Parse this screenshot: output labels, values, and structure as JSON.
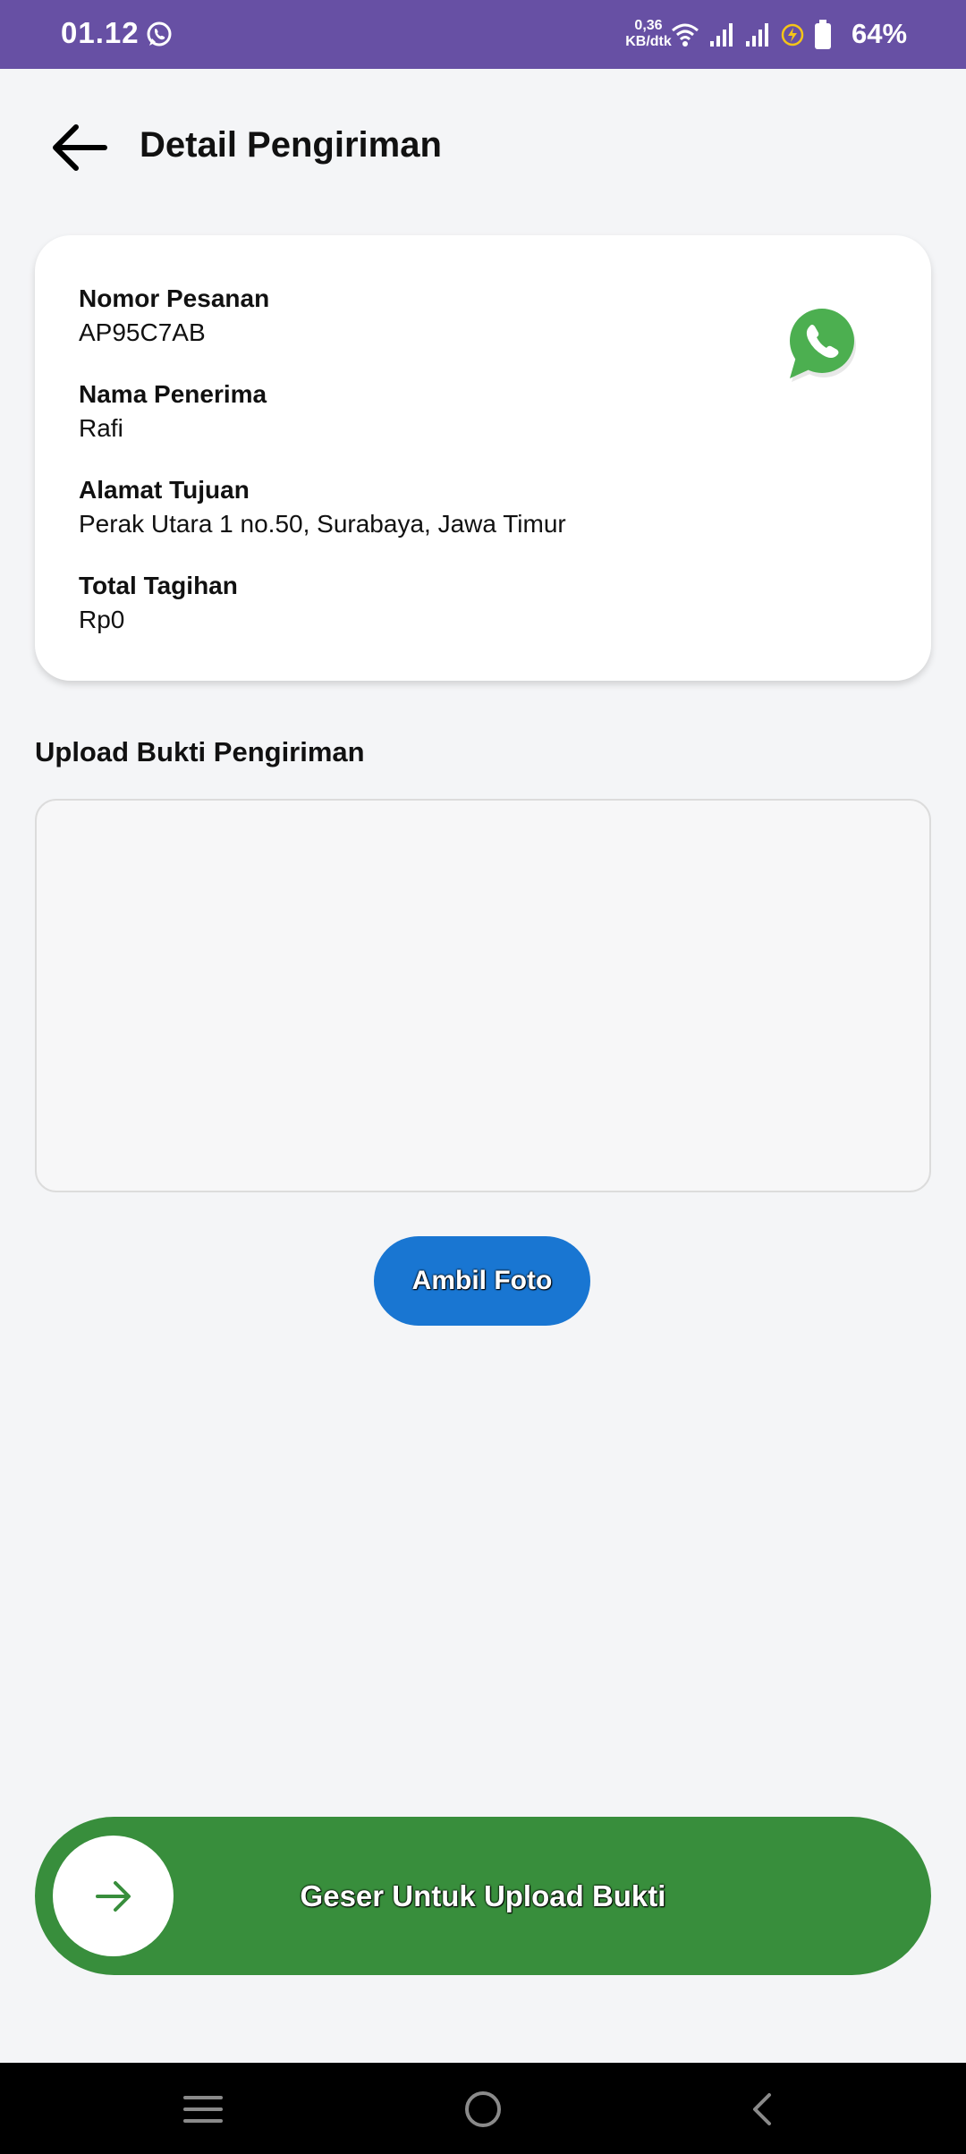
{
  "status_bar": {
    "time": "01.12",
    "net_speed_value": "0,36",
    "net_speed_unit": "KB/dtk",
    "battery_percent": "64%",
    "colors": {
      "background": "#6750a4"
    }
  },
  "header": {
    "title": "Detail Pengiriman",
    "back_icon": "arrow-left-icon"
  },
  "order": {
    "order_number_label": "Nomor Pesanan",
    "order_number": "AP95C7AB",
    "recipient_label": "Nama Penerima",
    "recipient": "Rafi",
    "address_label": "Alamat Tujuan",
    "address": "Perak Utara 1 no.50, Surabaya, Jawa Timur",
    "total_label": "Total Tagihan",
    "total": "Rp0",
    "contact_icon": "whatsapp-icon"
  },
  "upload": {
    "title": "Upload Bukti Pengiriman",
    "camera_button_label": "Ambil Foto"
  },
  "slider": {
    "label": "Geser Untuk Upload Bukti",
    "handle_icon": "arrow-right-icon",
    "colors": {
      "track": "#388e3c",
      "primary_button": "#1976d2"
    }
  },
  "nav": {
    "recents_icon": "menu-icon",
    "home_icon": "circle-home-icon",
    "back_icon": "chevron-left-icon"
  }
}
